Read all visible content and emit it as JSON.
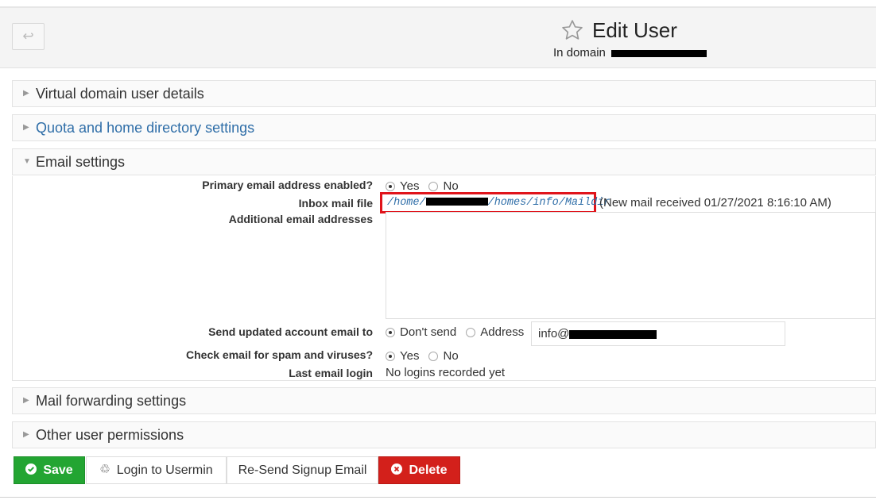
{
  "header": {
    "title": "Edit User",
    "subtitle_prefix": "In domain"
  },
  "sections": {
    "virtual_domain": "Virtual domain user details",
    "quota": "Quota and home directory settings",
    "email": "Email settings",
    "forwarding": "Mail forwarding settings",
    "permissions": "Other user permissions"
  },
  "email_settings": {
    "primary_label": "Primary email address enabled?",
    "primary_yes": "Yes",
    "primary_no": "No",
    "primary_selected": "Yes",
    "inbox_label": "Inbox mail file",
    "inbox_path_prefix": "/home/",
    "inbox_path_suffix": "/homes/info/Maildir",
    "inbox_note": "(New mail received 01/27/2021 8:16:10 AM)",
    "additional_label": "Additional email addresses",
    "additional_value": "",
    "send_label": "Send updated account email to",
    "send_dont": "Don't send",
    "send_address": "Address",
    "send_selected": "Don't send",
    "address_prefix": "info@",
    "spam_label": "Check email for spam and viruses?",
    "spam_yes": "Yes",
    "spam_no": "No",
    "spam_selected": "Yes",
    "last_login_label": "Last email login",
    "last_login_value": "No logins recorded yet"
  },
  "buttons": {
    "save": "Save",
    "usermin": "Login to Usermin",
    "resend": "Re-Send Signup Email",
    "delete": "Delete"
  },
  "colors": {
    "save": "#23a532",
    "delete": "#d3201b",
    "link": "#2f6ea8",
    "highlight": "#e0141b"
  },
  "icons": {
    "back": "back-arrow-icon",
    "star": "star-icon",
    "save": "check-circle-icon",
    "usermin": "recycle-icon",
    "delete": "times-circle-icon"
  }
}
